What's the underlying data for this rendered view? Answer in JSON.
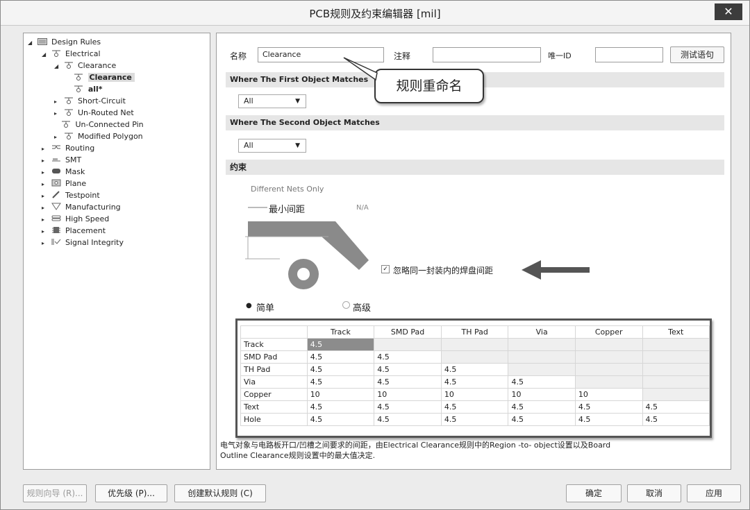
{
  "window": {
    "title": "PCB规则及约束编辑器 [mil]",
    "close": "✕"
  },
  "tree": {
    "items": [
      {
        "label": "Design Rules"
      },
      {
        "label": "Electrical"
      },
      {
        "label": "Clearance"
      },
      {
        "label": "Clearance"
      },
      {
        "label": "all*"
      },
      {
        "label": "Short-Circuit"
      },
      {
        "label": "Un-Routed Net"
      },
      {
        "label": "Un-Connected Pin"
      },
      {
        "label": "Modified Polygon"
      },
      {
        "label": "Routing"
      },
      {
        "label": "SMT"
      },
      {
        "label": "Mask"
      },
      {
        "label": "Plane"
      },
      {
        "label": "Testpoint"
      },
      {
        "label": "Manufacturing"
      },
      {
        "label": "High Speed"
      },
      {
        "label": "Placement"
      },
      {
        "label": "Signal Integrity"
      }
    ]
  },
  "form": {
    "name_label": "名称",
    "name_value": "Clearance",
    "comment_label": "注释",
    "comment_value": "",
    "uid_label": "唯一ID",
    "uid_value": "",
    "test_button": "测试语句"
  },
  "callout": "规则重命名",
  "first_match": {
    "title": "Where The First Object Matches",
    "value": "All"
  },
  "second_match": {
    "title": "Where The Second Object Matches",
    "value": "All"
  },
  "constraints": {
    "title": "约束",
    "different_nets": "Different Nets Only",
    "min_clearance_label": "最小间距",
    "min_clearance_value": "N/A",
    "ignore_pads_label": "忽略同一封装内的焊盘间距",
    "ignore_pads_checked": true,
    "mode_simple": "简单",
    "mode_advanced": "高级",
    "mode_selected": "simple"
  },
  "matrix": {
    "columns": [
      "Track",
      "SMD Pad",
      "TH Pad",
      "Via",
      "Copper",
      "Text"
    ],
    "rows": [
      {
        "name": "Track",
        "values": [
          "4.5",
          "",
          "",
          "",
          "",
          ""
        ]
      },
      {
        "name": "SMD Pad",
        "values": [
          "4.5",
          "4.5",
          "",
          "",
          "",
          ""
        ]
      },
      {
        "name": "TH Pad",
        "values": [
          "4.5",
          "4.5",
          "4.5",
          "",
          "",
          ""
        ]
      },
      {
        "name": "Via",
        "values": [
          "4.5",
          "4.5",
          "4.5",
          "4.5",
          "",
          ""
        ]
      },
      {
        "name": "Copper",
        "values": [
          "10",
          "10",
          "10",
          "10",
          "10",
          ""
        ]
      },
      {
        "name": "Text",
        "values": [
          "4.5",
          "4.5",
          "4.5",
          "4.5",
          "4.5",
          "4.5"
        ]
      },
      {
        "name": "Hole",
        "values": [
          "4.5",
          "4.5",
          "4.5",
          "4.5",
          "4.5",
          "4.5"
        ]
      }
    ]
  },
  "description": {
    "line1": "电气对象与电路板开口/凹槽之间要求的间距，由Electrical Clearance规则中的Region -to- object设置以及Board",
    "line2": "Outline Clearance规则设置中的最大值决定."
  },
  "buttons": {
    "wizard": "规则向导 (R)...",
    "priority": "优先级 (P)...",
    "create_default": "创建默认规则 (C)",
    "ok": "确定",
    "cancel": "取消",
    "apply": "应用"
  },
  "colors": {
    "accent_dark": "#3c3c3c",
    "selected_cell": "#8c8c8c",
    "matrix_border": "#555555"
  }
}
